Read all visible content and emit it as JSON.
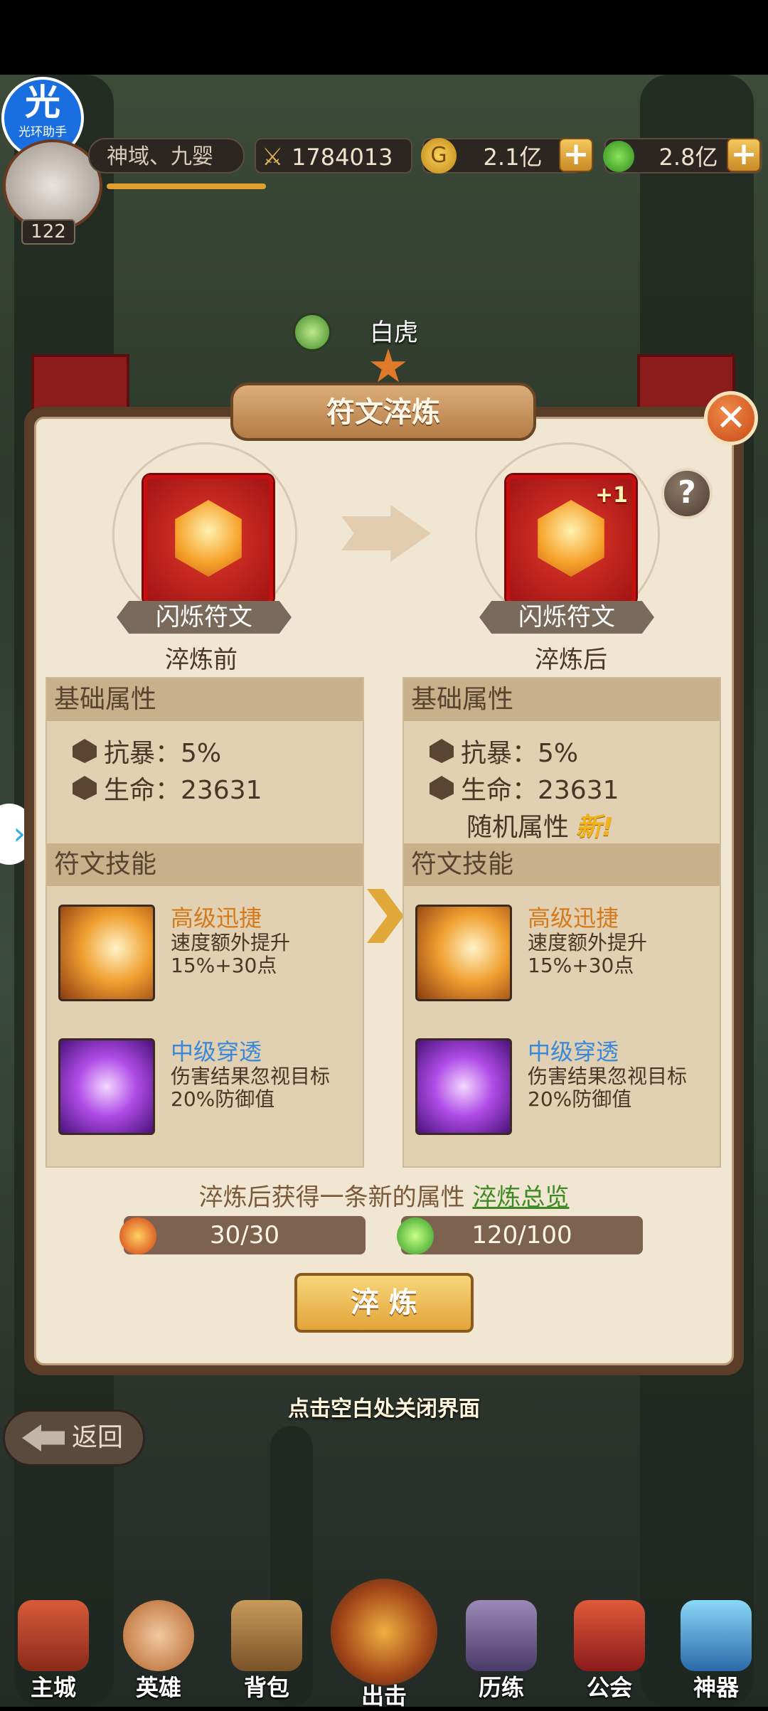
{
  "colors": {
    "accent": "#e2a43a",
    "panel": "#f1e6d2",
    "skill_gold": "#d47a1a",
    "skill_blue": "#3a88d8",
    "link_green": "#3f8a24",
    "new_gold": "#f2b21a"
  },
  "top_bar": {
    "app_badge": "光环助手",
    "level": "122",
    "server_name": "神域、九婴",
    "power": "1784013",
    "gold": "2.1亿",
    "potion": "2.8亿"
  },
  "hero": {
    "name": "白虎"
  },
  "dialog": {
    "title": "符文淬炼",
    "before": {
      "rune_name": "闪烁符文",
      "label": "淬炼前"
    },
    "after": {
      "rune_name": "闪烁符文",
      "label": "淬炼后",
      "plus": "+1"
    },
    "base_attr_header": "基础属性",
    "skills_header": "符文技能",
    "before_attrs": [
      {
        "icon": "crit-resist-icon",
        "text": "抗暴：5%"
      },
      {
        "icon": "hp-icon",
        "text": "生命：23631"
      }
    ],
    "after_attrs": [
      {
        "icon": "crit-resist-icon",
        "text": "抗暴：5%"
      },
      {
        "icon": "hp-icon",
        "text": "生命：23631"
      }
    ],
    "random_attr": "随机属性",
    "new_tag": "新!",
    "skills": [
      {
        "icon": "swift-boot-icon",
        "name": "高级迅捷",
        "desc": "速度额外提升15%+30点"
      },
      {
        "icon": "penetrate-icon",
        "name": "中级穿透",
        "desc": "伤害结果忽视目标20%防御值"
      }
    ],
    "footer_note": "淬炼后获得一条新的属性",
    "overview_link": "淬炼总览",
    "resource_1": "30/30",
    "resource_2": "120/100",
    "refine_button": "淬 炼"
  },
  "close_hint": "点击空白处关闭界面",
  "back_button": "返回",
  "nav": [
    "主城",
    "英雄",
    "背包",
    "出击",
    "历练",
    "公会",
    "神器"
  ]
}
